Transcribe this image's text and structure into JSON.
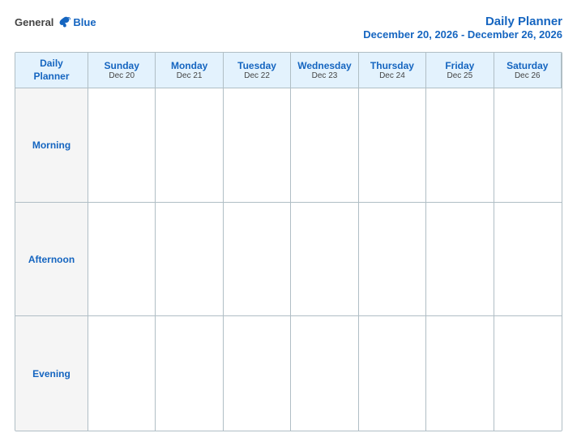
{
  "header": {
    "logo": {
      "general": "General",
      "blue": "Blue"
    },
    "title": "Daily Planner",
    "subtitle": "December 20, 2026 - December 26, 2026"
  },
  "calendar": {
    "corner": {
      "line1": "Daily",
      "line2": "Planner"
    },
    "days": [
      {
        "name": "Sunday",
        "date": "Dec 20"
      },
      {
        "name": "Monday",
        "date": "Dec 21"
      },
      {
        "name": "Tuesday",
        "date": "Dec 22"
      },
      {
        "name": "Wednesday",
        "date": "Dec 23"
      },
      {
        "name": "Thursday",
        "date": "Dec 24"
      },
      {
        "name": "Friday",
        "date": "Dec 25"
      },
      {
        "name": "Saturday",
        "date": "Dec 26"
      }
    ],
    "periods": [
      "Morning",
      "Afternoon",
      "Evening"
    ]
  }
}
